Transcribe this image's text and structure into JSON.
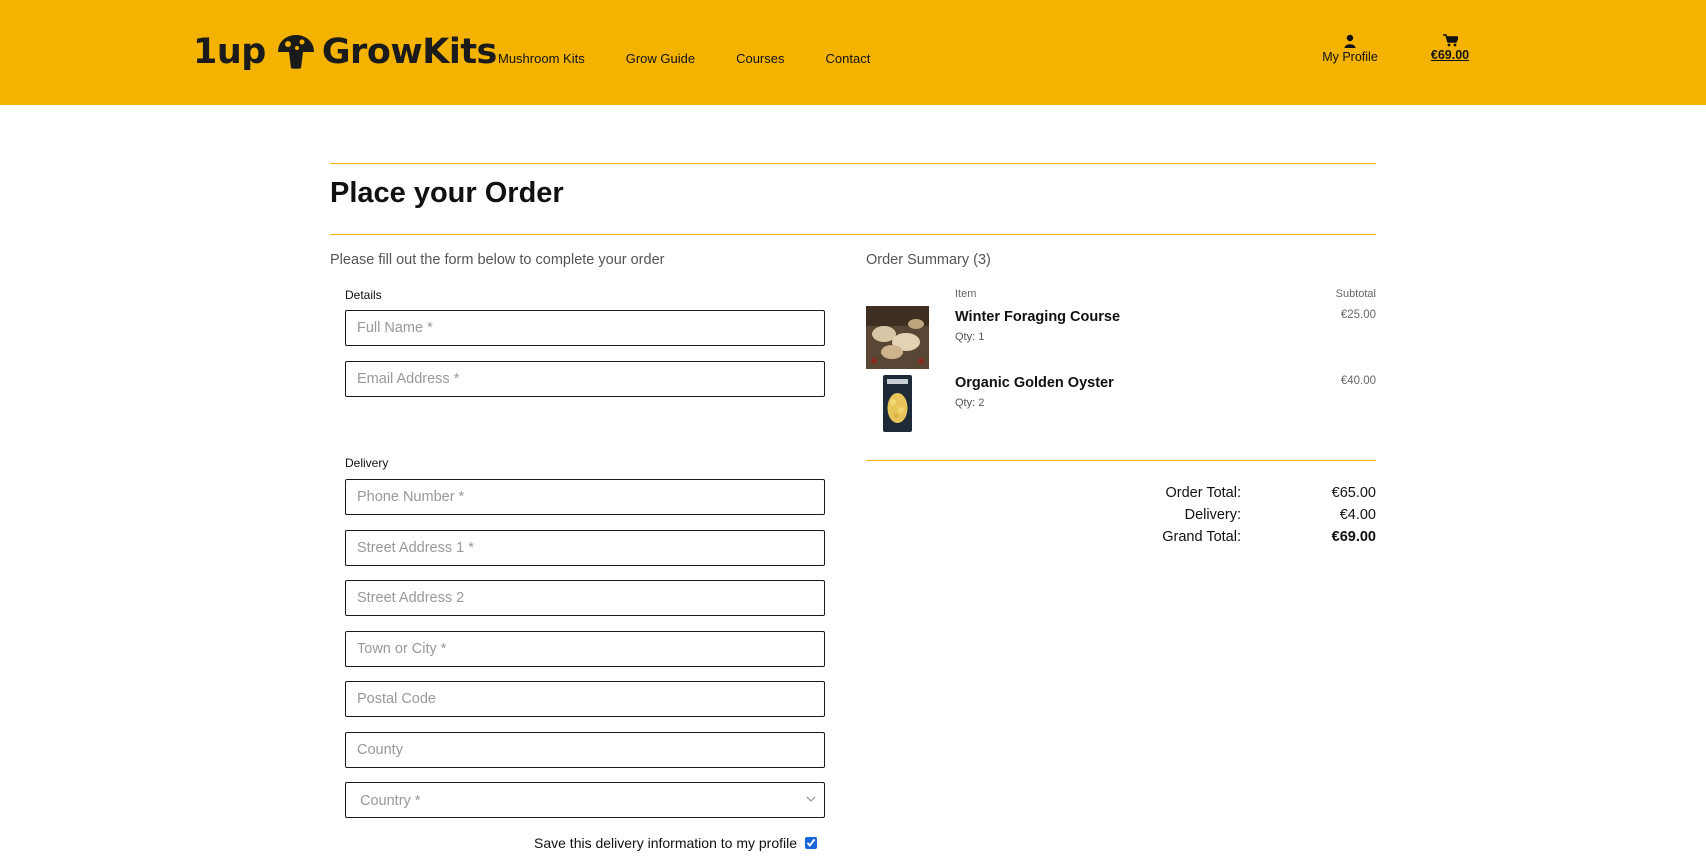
{
  "brand": {
    "logo_left": "1up",
    "logo_right": "GrowKits",
    "accent": "#f5b301"
  },
  "nav": {
    "items": [
      "Mushroom Kits",
      "Grow Guide",
      "Courses",
      "Contact"
    ]
  },
  "account": {
    "profile_label": "My Profile",
    "cart_total": "€69.00"
  },
  "page": {
    "title": "Place your Order",
    "intro": "Please fill out the form below to complete your order"
  },
  "form": {
    "details_label": "Details",
    "full_name_placeholder": "Full Name *",
    "email_placeholder": "Email Address *",
    "delivery_label": "Delivery",
    "phone_placeholder": "Phone Number *",
    "street1_placeholder": "Street Address 1 *",
    "street2_placeholder": "Street Address 2",
    "town_placeholder": "Town or City *",
    "postal_placeholder": "Postal Code",
    "county_placeholder": "County",
    "country_placeholder": "Country *",
    "save_label": "Save this delivery information to my profile",
    "save_checked": true
  },
  "summary": {
    "title": "Order Summary (3)",
    "col_item": "Item",
    "col_subtotal": "Subtotal",
    "items": [
      {
        "name": "Winter Foraging Course",
        "qty": "Qty: 1",
        "subtotal": "€25.00"
      },
      {
        "name": "Organic Golden Oyster",
        "qty": "Qty: 2",
        "subtotal": "€40.00"
      }
    ],
    "order_total_label": "Order Total:",
    "order_total": "€65.00",
    "delivery_label": "Delivery:",
    "delivery": "€4.00",
    "grand_total_label": "Grand Total:",
    "grand_total": "€69.00"
  }
}
